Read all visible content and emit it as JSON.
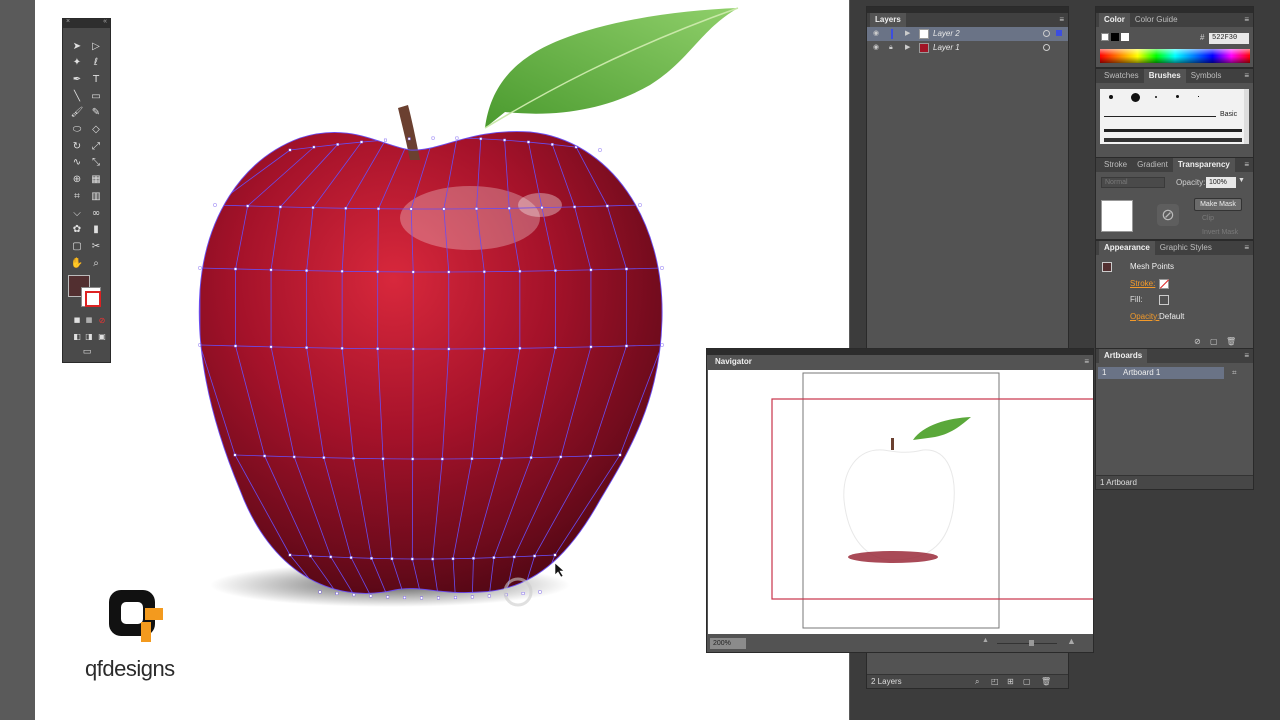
{
  "tools_panel": {
    "icons": [
      "selection-tool-icon",
      "direct-selection-tool-icon",
      "magic-wand-tool-icon",
      "lasso-tool-icon",
      "pen-tool-icon",
      "type-tool-icon",
      "line-segment-tool-icon",
      "rectangle-tool-icon",
      "paintbrush-tool-icon",
      "pencil-tool-icon",
      "blob-brush-tool-icon",
      "eraser-tool-icon",
      "rotate-tool-icon",
      "scale-tool-icon",
      "warp-tool-icon",
      "free-transform-tool-icon",
      "shape-builder-tool-icon",
      "perspective-grid-tool-icon",
      "mesh-tool-icon",
      "gradient-tool-icon",
      "eyedropper-tool-icon",
      "blend-tool-icon",
      "symbol-sprayer-tool-icon",
      "column-graph-tool-icon",
      "artboard-tool-icon",
      "slice-tool-icon",
      "hand-tool-icon",
      "zoom-tool-icon"
    ],
    "fill_color": "#522f30"
  },
  "logo": {
    "mark": "Q",
    "text": "qfdesigns"
  },
  "layers": {
    "tab": "Layers",
    "rows": [
      {
        "name": "Layer 2",
        "color": "#3c4ee0",
        "selected": true
      },
      {
        "name": "Layer 1",
        "color": "#d84040",
        "selected": false
      }
    ],
    "footer": "2 Layers"
  },
  "color": {
    "tabs": [
      "Color",
      "Color Guide"
    ],
    "hash": "#",
    "hex": "522F30"
  },
  "brushes": {
    "tabs": [
      "Swatches",
      "Brushes",
      "Symbols"
    ],
    "basic_label": "Basic"
  },
  "transparency": {
    "tabs": [
      "Stroke",
      "Gradient",
      "Transparency"
    ],
    "blend_mode": "Normal",
    "opacity_label": "Opacity:",
    "opacity_value": "100%",
    "make_mask": "Make Mask",
    "clip": "Clip",
    "invert_mask": "Invert Mask"
  },
  "appearance": {
    "tabs": [
      "Appearance",
      "Graphic Styles"
    ],
    "title": "Mesh Points",
    "stroke_label": "Stroke:",
    "fill_label": "Fill:",
    "opacity_label": "Opacity:",
    "opacity_value": "Default"
  },
  "artboards": {
    "tab": "Artboards",
    "rows": [
      {
        "index": "1",
        "name": "Artboard 1"
      }
    ],
    "footer": "1 Artboard"
  },
  "navigator": {
    "tab": "Navigator",
    "zoom": "200%"
  }
}
